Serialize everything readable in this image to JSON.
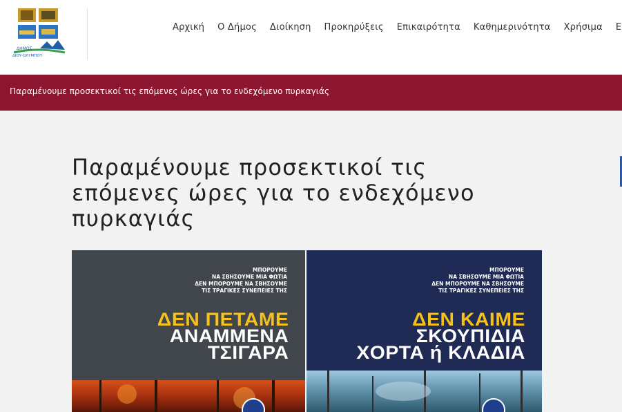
{
  "header": {
    "logo_text_line1": "ΔΗΜΟΣ",
    "logo_text_line2": "ΔΙΟΥ-ΟΛΥΜΠΟΥ",
    "nav": [
      {
        "label": "Αρχική"
      },
      {
        "label": "Ο Δήμος"
      },
      {
        "label": "Διοίκηση"
      },
      {
        "label": "Προκηρύξεις"
      },
      {
        "label": "Επικαιρότητα"
      },
      {
        "label": "Καθημερινότητα"
      },
      {
        "label": "Χρήσιμα"
      },
      {
        "label": "Ε"
      }
    ]
  },
  "alert": {
    "text": "Παραμένουμε προσεκτικοί τις επόμενες ώρες για το ενδεχόμενο πυρκαγιάς"
  },
  "article": {
    "title": "Παραμένουμε προσεκτικοί τις επόμενες ώρες για το ενδεχόμενο πυρκαγιάς"
  },
  "posters": {
    "left": {
      "small": [
        "ΜΠΟΡΟΥΜΕ",
        "ΝΑ ΣΒΗΣΟΥΜΕ ΜΙΑ ΦΩΤΙΑ",
        "ΔΕΝ ΜΠΟΡΟΥΜΕ ΝΑ ΣΒΗΣΟΥΜΕ",
        "ΤΙΣ ΤΡΑΓΙΚΕΣ ΣΥΝΕΠΕΙΕΣ ΤΗΣ"
      ],
      "headline_yellow": "ΔΕΝ ΠΕΤΑΜΕ",
      "headline_white_1": "ΑΝΑΜΜΕΝΑ",
      "headline_white_2": "ΤΣΙΓΑΡΑ"
    },
    "right": {
      "small": [
        "ΜΠΟΡΟΥΜΕ",
        "ΝΑ ΣΒΗΣΟΥΜΕ ΜΙΑ ΦΩΤΙΑ",
        "ΔΕΝ ΜΠΟΡΟΥΜΕ ΝΑ ΣΒΗΣΟΥΜΕ",
        "ΤΙΣ ΤΡΑΓΙΚΕΣ ΣΥΝΕΠΕΙΕΣ ΤΗΣ"
      ],
      "headline_yellow": "ΔΕΝ ΚΑΙΜΕ",
      "headline_white_1": "ΣΚΟΥΠΙΔΙΑ",
      "headline_white_2": "ΧΟΡΤΑ ή ΚΛΑΔΙΑ"
    }
  },
  "colors": {
    "alert_bg": "#8c1630",
    "poster_yellow": "#f6c21a",
    "poster_left_bg": "#41464d",
    "poster_right_bg": "#1f2a55"
  }
}
